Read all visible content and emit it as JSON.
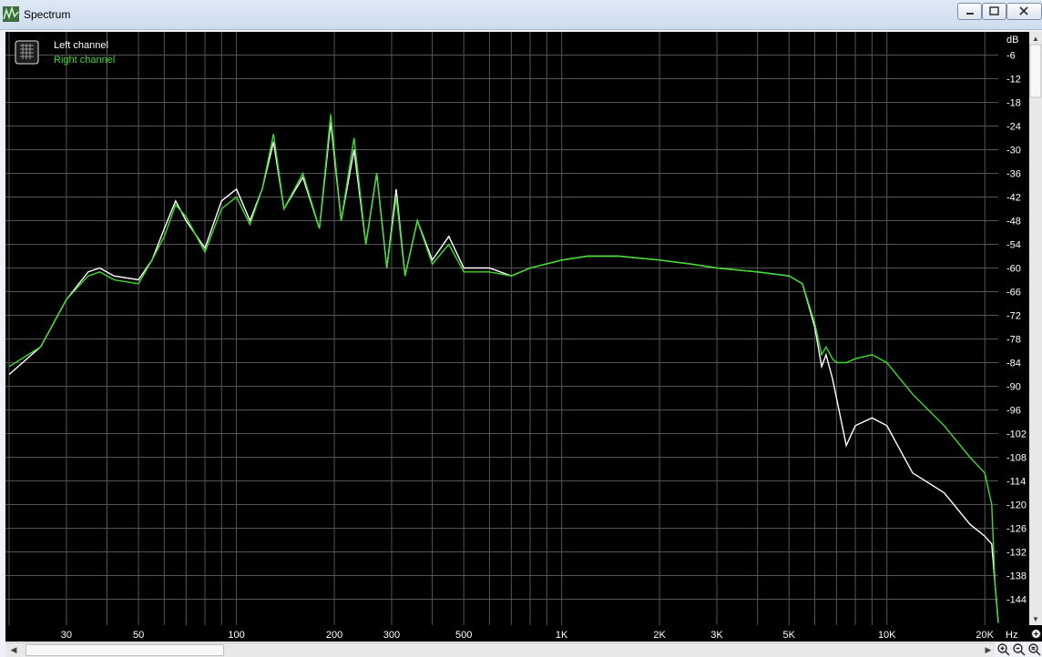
{
  "window": {
    "title": "Spectrum"
  },
  "legend": {
    "left_label": "Left channel",
    "right_label": "Right channel"
  },
  "colors": {
    "left": "#ffffff",
    "right": "#3ddc2a",
    "grid": "#555555",
    "plot_bg": "#000000",
    "axis_text": "#ffffff"
  },
  "axis": {
    "y_unit": "dB",
    "y_ticks": [
      "-6",
      "-12",
      "-18",
      "-24",
      "-30",
      "-36",
      "-42",
      "-48",
      "-54",
      "-60",
      "-66",
      "-72",
      "-78",
      "-84",
      "-90",
      "-96",
      "-102",
      "-108",
      "-114",
      "-120",
      "-126",
      "-132",
      "-138",
      "-144"
    ],
    "x_unit": "Hz",
    "x_ticks": [
      {
        "label": "30",
        "value": 30
      },
      {
        "label": "50",
        "value": 50
      },
      {
        "label": "100",
        "value": 100
      },
      {
        "label": "200",
        "value": 200
      },
      {
        "label": "300",
        "value": 300
      },
      {
        "label": "500",
        "value": 500
      },
      {
        "label": "1K",
        "value": 1000
      },
      {
        "label": "2K",
        "value": 2000
      },
      {
        "label": "3K",
        "value": 3000
      },
      {
        "label": "5K",
        "value": 5000
      },
      {
        "label": "10K",
        "value": 10000
      },
      {
        "label": "20K",
        "value": 20000
      }
    ]
  },
  "chart_data": {
    "type": "line",
    "x_scale": "log",
    "xlim": [
      20,
      22000
    ],
    "ylim": [
      -150,
      0
    ],
    "grid": true,
    "legend_position": "top-left",
    "xlabel": "Hz",
    "ylabel": "dB",
    "series": [
      {
        "name": "Left channel",
        "x": [
          20,
          25,
          30,
          35,
          38,
          42,
          50,
          55,
          60,
          65,
          70,
          80,
          90,
          100,
          110,
          120,
          130,
          140,
          160,
          180,
          195,
          210,
          230,
          250,
          270,
          290,
          310,
          330,
          360,
          400,
          450,
          500,
          600,
          700,
          800,
          1000,
          1200,
          1500,
          2000,
          2500,
          3000,
          4000,
          5000,
          5500,
          6000,
          6300,
          6500,
          6800,
          7000,
          7500,
          8000,
          9000,
          10000,
          12000,
          15000,
          18000,
          20000,
          21000,
          21500,
          22000
        ],
        "y": [
          -87,
          -80,
          -68,
          -61,
          -60,
          -62,
          -63,
          -58,
          -50,
          -43,
          -48,
          -55,
          -43,
          -40,
          -48,
          -40,
          -28,
          -45,
          -37,
          -50,
          -23,
          -48,
          -30,
          -54,
          -36,
          -60,
          -40,
          -62,
          -48,
          -58,
          -52,
          -60,
          -60,
          -62,
          -60,
          -58,
          -57,
          -57,
          -58,
          -59,
          -60,
          -61,
          -62,
          -64,
          -75,
          -85,
          -82,
          -88,
          -93,
          -105,
          -100,
          -98,
          -100,
          -112,
          -117,
          -125,
          -128,
          -130,
          -140,
          -150
        ]
      },
      {
        "name": "Right channel",
        "x": [
          20,
          25,
          30,
          35,
          38,
          42,
          50,
          55,
          60,
          65,
          70,
          80,
          90,
          100,
          110,
          120,
          130,
          140,
          160,
          180,
          195,
          210,
          230,
          250,
          270,
          290,
          310,
          330,
          360,
          400,
          450,
          500,
          600,
          700,
          800,
          1000,
          1200,
          1500,
          2000,
          2500,
          3000,
          4000,
          5000,
          5500,
          6000,
          6300,
          6500,
          6800,
          7000,
          7500,
          8000,
          9000,
          10000,
          12000,
          15000,
          18000,
          20000,
          21000,
          21500,
          22000
        ],
        "y": [
          -85,
          -80,
          -68,
          -62,
          -61,
          -63,
          -64,
          -58,
          -52,
          -44,
          -47,
          -56,
          -45,
          -42,
          -49,
          -40,
          -26,
          -45,
          -36,
          -50,
          -21,
          -48,
          -27,
          -54,
          -36,
          -60,
          -42,
          -62,
          -48,
          -59,
          -54,
          -61,
          -61,
          -62,
          -60,
          -58,
          -57,
          -57,
          -58,
          -59,
          -60,
          -61,
          -62,
          -64,
          -74,
          -82,
          -80,
          -83,
          -84,
          -84,
          -83,
          -82,
          -84,
          -92,
          -100,
          -108,
          -112,
          -120,
          -140,
          -150
        ]
      }
    ]
  }
}
